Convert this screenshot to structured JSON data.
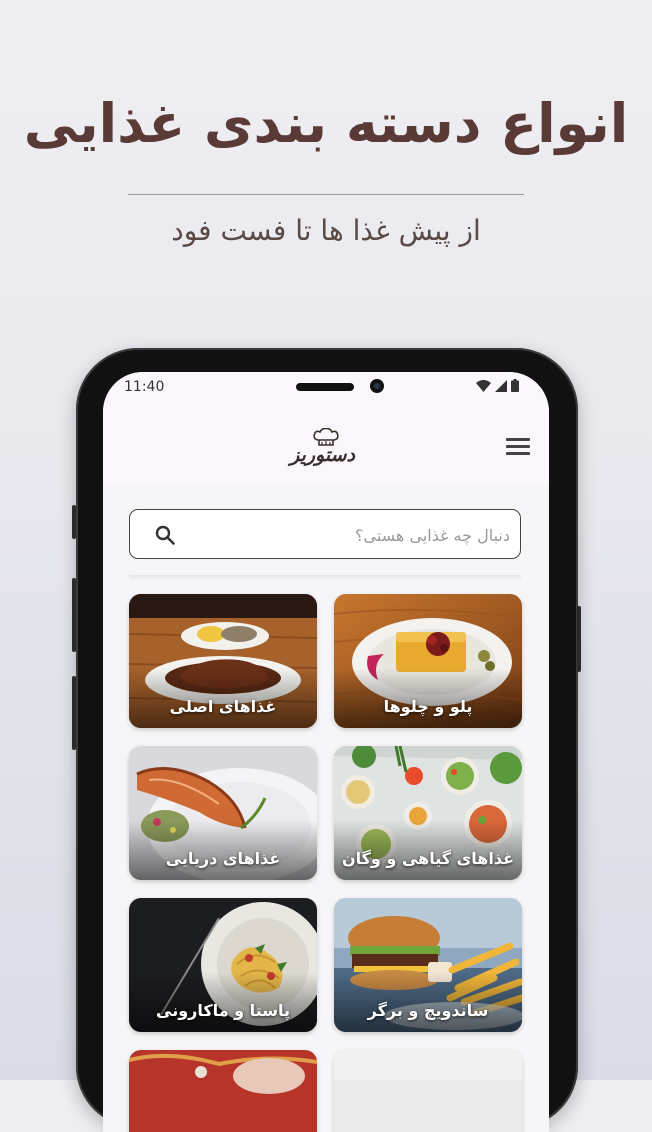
{
  "hero": {
    "title": "انواع دسته بندی غذایی",
    "subtitle": "از پیش غذا ها تا فست فود"
  },
  "status_bar": {
    "time": "11:40"
  },
  "header": {
    "logo_text": "دستوریز",
    "logo_icon": "chef-hat-icon",
    "menu_icon": "hamburger-menu-icon"
  },
  "search": {
    "placeholder": "دنبال چه غذایی هستی؟",
    "value": ""
  },
  "categories": [
    {
      "label": "پلو و چلوها"
    },
    {
      "label": "غذاهای اصلی"
    },
    {
      "label": "غذاهای گیاهی و وگان"
    },
    {
      "label": "غذاهای دریایی"
    },
    {
      "label": "ساندویچ و برگر"
    },
    {
      "label": "پاستا و ماکارونی"
    }
  ],
  "colors": {
    "title": "#5a3a36",
    "accent_dark": "#3a2f2d"
  }
}
